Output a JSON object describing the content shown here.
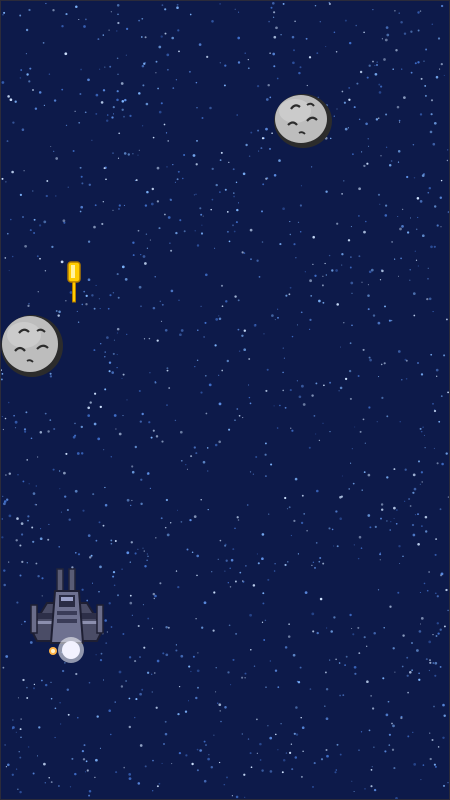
{
  "game": {
    "background_color": "#0d1a4a",
    "star_colors": [
      "#7fb6ff",
      "#5d8fe6",
      "#cfe3ff",
      "#3f6ec9"
    ],
    "asteroid_color": "#bdbdbd",
    "asteroid_outline": "#2c2c2c",
    "bullet_color": "#ffcc00",
    "ship_color": "#5a5c75",
    "entities": {
      "player": "spaceship-icon",
      "projectile": "laser-bullet-icon",
      "obstacles": [
        "asteroid-icon",
        "asteroid-icon"
      ]
    }
  }
}
